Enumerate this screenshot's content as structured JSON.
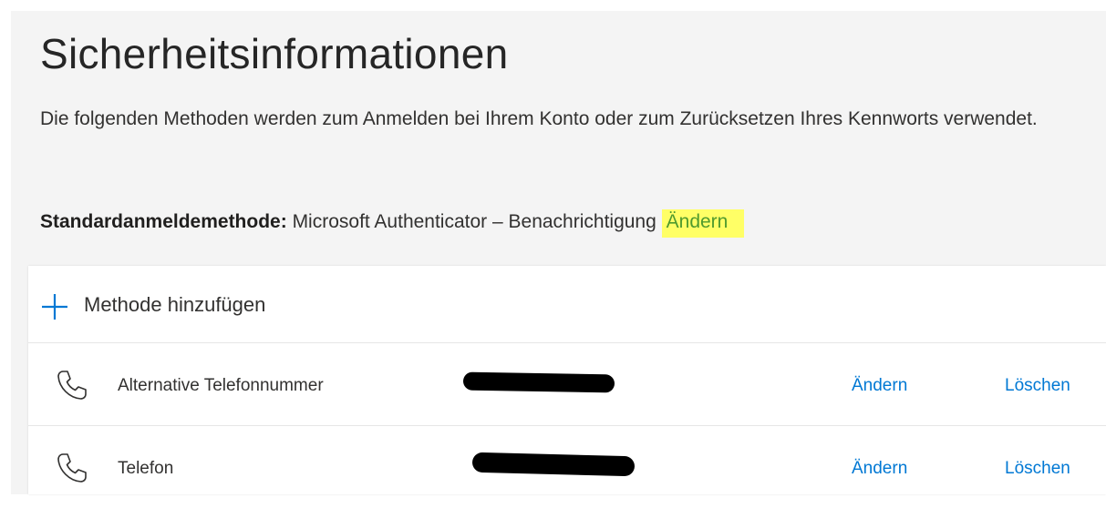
{
  "page": {
    "title": "Sicherheitsinformationen",
    "description": "Die folgenden Methoden werden zum Anmelden bei Ihrem Konto oder zum Zurücksetzen Ihres Kennworts verwendet."
  },
  "default_method": {
    "label": "Standardanmeldemethode:",
    "value": "Microsoft Authenticator – Benachrichtigung",
    "change_label": "Ändern",
    "highlight_color": "#ffff66"
  },
  "methods_card": {
    "add_label": "Methode hinzufügen",
    "add_icon": "plus-icon",
    "accent_color": "#0078d4",
    "rows": [
      {
        "icon": "phone-icon",
        "name": "Alternative Telefonnummer",
        "value_redacted": true,
        "change_label": "Ändern",
        "delete_label": "Löschen"
      },
      {
        "icon": "phone-icon",
        "name": "Telefon",
        "value_redacted": true,
        "change_label": "Ändern",
        "delete_label": "Löschen"
      }
    ]
  }
}
